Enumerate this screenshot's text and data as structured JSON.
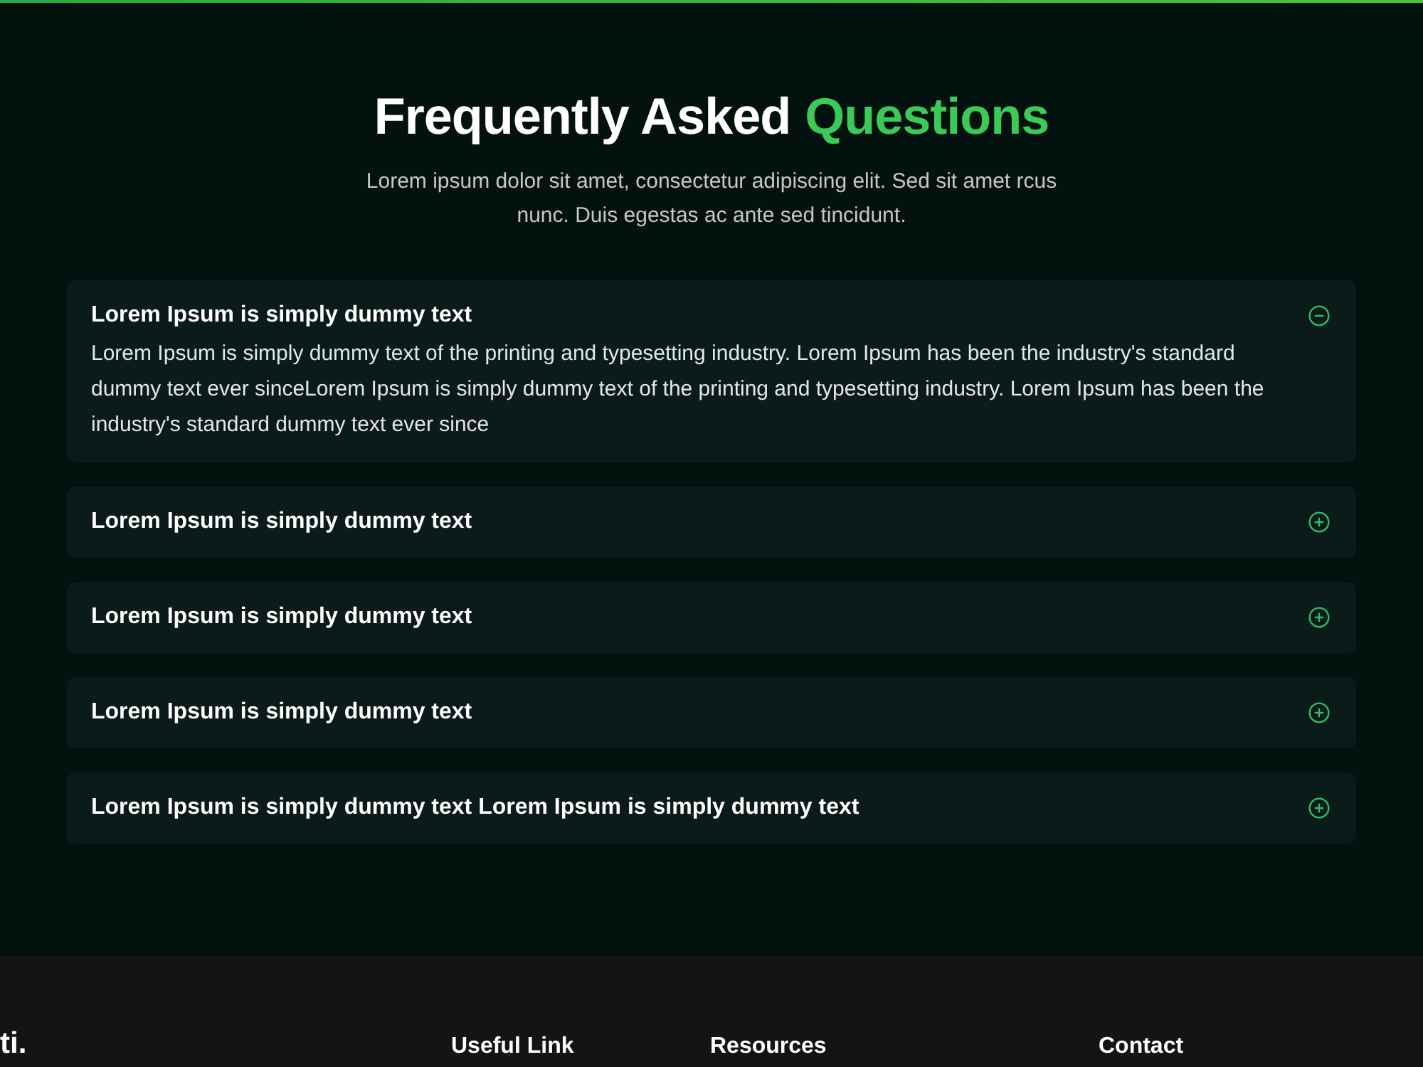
{
  "header": {
    "title": "Frequently Asked",
    "title_highlight": "Questions",
    "subtitle": "Lorem ipsum dolor sit amet, consectetur adipiscing elit. Sed sit amet rcus nunc. Duis egestas ac ante sed tincidunt."
  },
  "faq": [
    {
      "question": "Lorem Ipsum is simply dummy text",
      "answer": "Lorem Ipsum is simply dummy text of the printing and typesetting industry. Lorem Ipsum has been the industry's standard dummy text ever sinceLorem Ipsum is simply dummy text of the printing and typesetting industry. Lorem Ipsum has been the industry's standard dummy text ever since",
      "expanded": true
    },
    {
      "question": "Lorem Ipsum is simply dummy text",
      "expanded": false
    },
    {
      "question": "Lorem Ipsum is simply dummy text",
      "expanded": false
    },
    {
      "question": "Lorem Ipsum is simply dummy text",
      "expanded": false
    },
    {
      "question": "Lorem Ipsum is simply dummy text Lorem Ipsum is simply dummy text",
      "expanded": false
    }
  ],
  "footer": {
    "brand": "ti.",
    "columns": [
      {
        "heading": "Useful Link"
      },
      {
        "heading": "Resources"
      },
      {
        "heading": "Contact"
      }
    ]
  }
}
